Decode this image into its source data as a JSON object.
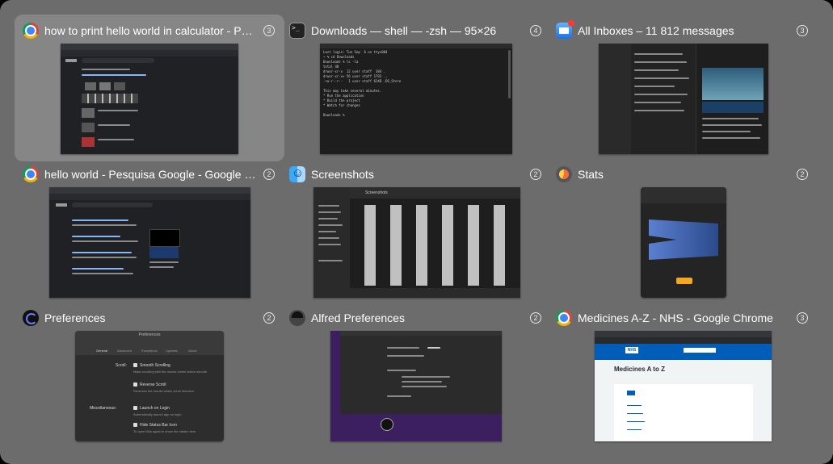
{
  "switcher": {
    "windows": [
      {
        "title": "how to print hello world in calculator - Pes…",
        "count": "3",
        "icon": "chrome-icon"
      },
      {
        "title": "Downloads — shell — -zsh — 95×26",
        "count": "4",
        "icon": "terminal-icon"
      },
      {
        "title": "All Inboxes – 11 812 messages",
        "count": "3",
        "icon": "mail-icon"
      },
      {
        "title": "hello world - Pesquisa Google - Google Ch…",
        "count": "2",
        "icon": "chrome-icon"
      },
      {
        "title": "Screenshots",
        "count": "2",
        "icon": "finder-icon"
      },
      {
        "title": "Stats",
        "count": "2",
        "icon": "stats-icon"
      },
      {
        "title": "Preferences",
        "count": "2",
        "icon": "preferences-icon"
      },
      {
        "title": "Alfred Preferences",
        "count": "2",
        "icon": "alfred-icon"
      },
      {
        "title": "Medicines A-Z - NHS - Google Chrome",
        "count": "3",
        "icon": "chrome-icon"
      }
    ],
    "selected_index": 0,
    "colors": {
      "background": "#6c6c6c",
      "selected": "#868686",
      "nhs_blue": "#005eb8",
      "alfred_purple": "#3b1f5e"
    }
  },
  "thumbs": {
    "prefs": {
      "title": "Preferences",
      "tabs": [
        "General",
        "Advanced",
        "Exceptions",
        "Updates",
        "About"
      ],
      "scroll_label": "Scroll:",
      "smooth_scrolling": "Smooth Scrolling",
      "smooth_desc": "Make scrolling with the mouse wheel action smooth",
      "reverse_scroll": "Reverse Scroll",
      "reverse_desc": "Reverses the mouse wheel scroll direction",
      "misc_label": "Miscellaneous:",
      "launch_login": "Launch on Login",
      "launch_desc": "Automatically launch app on login",
      "hide_status": "Hide Status Bar Icon",
      "hide_desc": "To open Mos again to show the hidden item"
    },
    "nhs": {
      "logo": "NHS",
      "heading": "Medicines A to Z"
    },
    "finder": {
      "title": "Screenshots"
    },
    "terminal": {
      "lines": "Last login: Tue Sep  6 on ttys004\n~ % cd Downloads\nDownloads % ls -la\ntotal 48\ndrwxr-xr-x  12 user staff  384 .\ndrwxr-xr-x+ 56 user staff 1792 ..\n-rw-r--r--   1 user staff 6148 .DS_Store\n\nThis may take several minutes.\n* Run the application\n* Build the project\n* Watch for changes\n\nDownloads % "
    }
  }
}
